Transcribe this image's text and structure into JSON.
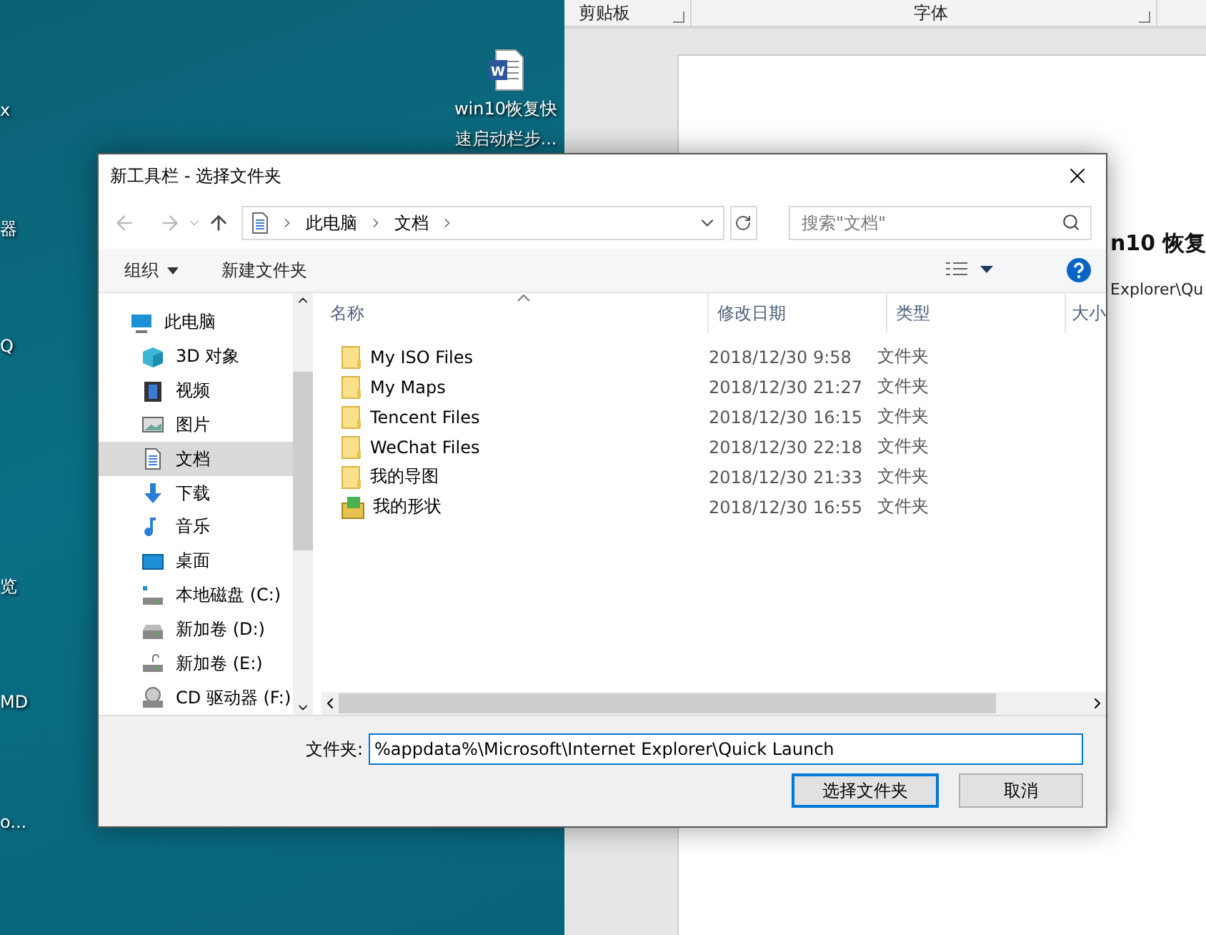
{
  "desktop": {
    "edge_labels": [
      "x",
      "器",
      "Q",
      "览",
      "MD",
      "o..."
    ],
    "icons": [
      {
        "kind": "word",
        "badge": "W",
        "label_lines": [
          "win10恢复快",
          "速启动栏步..."
        ]
      }
    ]
  },
  "word": {
    "ribbon_groups": [
      "剪贴板",
      "字体"
    ],
    "heading": "n10 恢复",
    "line": "Explorer\\Qu"
  },
  "dialog": {
    "title": "新工具栏 - 选择文件夹",
    "breadcrumb": [
      "此电脑",
      "文档"
    ],
    "search": {
      "placeholder": "搜索\"文档\""
    },
    "toolbar": {
      "organize": "组织",
      "new_folder": "新建文件夹"
    },
    "sidebar": [
      {
        "label": "此电脑",
        "kind": "pc",
        "selected": false,
        "children": [
          {
            "label": "3D 对象",
            "kind": "cube",
            "selected": false
          },
          {
            "label": "视频",
            "kind": "video",
            "selected": false
          },
          {
            "label": "图片",
            "kind": "picture",
            "selected": false
          },
          {
            "label": "文档",
            "kind": "document",
            "selected": true
          },
          {
            "label": "下载",
            "kind": "download",
            "selected": false
          },
          {
            "label": "音乐",
            "kind": "music",
            "selected": false
          },
          {
            "label": "桌面",
            "kind": "desktop",
            "selected": false
          },
          {
            "label": "本地磁盘 (C:)",
            "kind": "system-drive",
            "selected": false
          },
          {
            "label": "新加卷 (D:)",
            "kind": "drive",
            "selected": false
          },
          {
            "label": "新加卷 (E:)",
            "kind": "drive-lock",
            "selected": false
          },
          {
            "label": "CD 驱动器 (F:)",
            "kind": "cd",
            "selected": false
          }
        ]
      }
    ],
    "columns": [
      {
        "label": "名称",
        "sorted": true
      },
      {
        "label": "修改日期",
        "sorted": false
      },
      {
        "label": "类型",
        "sorted": false
      },
      {
        "label": "大小",
        "sorted": false
      }
    ],
    "files": [
      {
        "name": "My ISO Files",
        "date": "2018/12/30 9:58",
        "type": "文件夹",
        "kind": "folder"
      },
      {
        "name": "My Maps",
        "date": "2018/12/30 21:27",
        "type": "文件夹",
        "kind": "folder"
      },
      {
        "name": "Tencent Files",
        "date": "2018/12/30 16:15",
        "type": "文件夹",
        "kind": "folder"
      },
      {
        "name": "WeChat Files",
        "date": "2018/12/30 22:18",
        "type": "文件夹",
        "kind": "folder"
      },
      {
        "name": "我的导图",
        "date": "2018/12/30 21:33",
        "type": "文件夹",
        "kind": "folder"
      },
      {
        "name": "我的形状",
        "date": "2018/12/30 16:55",
        "type": "文件夹",
        "kind": "shapes"
      }
    ],
    "folder_field": {
      "label": "文件夹:",
      "value": "%appdata%\\Microsoft\\Internet Explorer\\Quick Launch",
      "focused": true
    },
    "buttons": [
      {
        "label": "选择文件夹",
        "default": true
      },
      {
        "label": "取消",
        "default": false
      }
    ]
  }
}
